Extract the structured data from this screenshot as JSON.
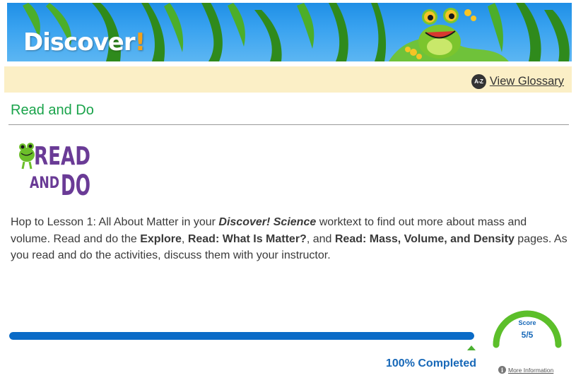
{
  "banner": {
    "brand_main": "Discover",
    "brand_bang": "!"
  },
  "glossary": {
    "icon_text": "A-Z",
    "label": "View Glossary"
  },
  "page": {
    "title": "Read and Do"
  },
  "logo": {
    "line1": "READ",
    "line2_a": "AND",
    "line2_b": "DO"
  },
  "content": {
    "p1": "Hop to Lesson 1: All About Matter in your ",
    "book": "Discover! Science",
    "p2": " worktext to find out more about mass and volume. Read and do the ",
    "s1": "Explore",
    "p3": ", ",
    "s2": "Read: What Is Matter?",
    "p4": ", and ",
    "s3": "Read: Mass, Volume, and Density",
    "p5": " pages. As you read and do the activities, discuss them with your instructor."
  },
  "progress": {
    "percent": 100,
    "label": "100% Completed"
  },
  "score": {
    "title": "Score",
    "value": "5/5",
    "earned": 5,
    "total": 5,
    "more_info": "More Information"
  },
  "colors": {
    "accent_green": "#19a34a",
    "progress_blue": "#0a6bc7",
    "gauge_green": "#5cbf2a",
    "glossary_bg": "#fbefc6"
  }
}
